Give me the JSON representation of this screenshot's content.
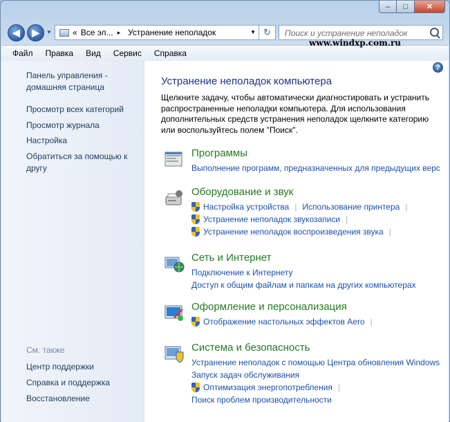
{
  "window": {
    "caption_buttons": {
      "minimize": "‒",
      "maximize": "□",
      "close": "✕"
    }
  },
  "navbar": {
    "back_icon": "arrow-left-icon",
    "forward_icon": "arrow-right-icon",
    "address_prefix": "«",
    "address_crumb1": "Все эл...",
    "address_separator": "▸",
    "address_crumb2": "Устранение неполадок",
    "search_placeholder": "Поиск и устранение неполадок"
  },
  "watermark": "www.windxp.com.ru",
  "menu": [
    "Файл",
    "Правка",
    "Вид",
    "Сервис",
    "Справка"
  ],
  "sidebar": {
    "home_link": "Панель управления - домашняя страница",
    "links": [
      "Просмотр всех категорий",
      "Просмотр журнала",
      "Настройка",
      "Обратиться за помощью к другу"
    ],
    "see_also_label": "См. также",
    "see_also_links": [
      "Центр поддержки",
      "Справка и поддержка",
      "Восстановление"
    ]
  },
  "main": {
    "help_icon": "?",
    "title": "Устранение неполадок компьютера",
    "description": "Щелкните задачу, чтобы автоматически диагностировать и устранить распространенные неполадки компьютера. Для использования дополнительных средств устранения неполадок щелкните категорию или воспользуйтесь полем \"Поиск\".",
    "categories": [
      {
        "title": "Программы",
        "icon": "programs-icon",
        "rows": [
          [
            {
              "text": "Выполнение программ, предназначенных для предыдущих версий Windows",
              "shield": false
            }
          ]
        ]
      },
      {
        "title": "Оборудование и звук",
        "icon": "hardware-sound-icon",
        "rows": [
          [
            {
              "text": "Настройка устройства",
              "shield": true
            },
            {
              "text": "Использование принтера",
              "shield": false
            }
          ],
          [
            {
              "text": "Устранение неполадок звукозаписи",
              "shield": true
            }
          ],
          [
            {
              "text": "Устранение неполадок воспроизведения звука",
              "shield": true
            }
          ]
        ]
      },
      {
        "title": "Сеть и Интернет",
        "icon": "network-internet-icon",
        "rows": [
          [
            {
              "text": "Подключение к Интернету",
              "shield": false
            }
          ],
          [
            {
              "text": "Доступ к общим файлам и папкам на других компьютерах",
              "shield": false
            }
          ]
        ]
      },
      {
        "title": "Оформление и персонализация",
        "icon": "appearance-personalization-icon",
        "rows": [
          [
            {
              "text": "Отображение настольных эффектов Aero",
              "shield": true
            }
          ]
        ]
      },
      {
        "title": "Система и безопасность",
        "icon": "system-security-icon",
        "rows": [
          [
            {
              "text": "Устранение неполадок с помощью Центра обновления Windows",
              "shield": false
            }
          ],
          [
            {
              "text": "Запуск задач обслуживания",
              "shield": false
            }
          ],
          [
            {
              "text": "Оптимизация энергопотребления",
              "shield": true
            }
          ],
          [
            {
              "text": "Поиск проблем производительности",
              "shield": false
            }
          ]
        ]
      }
    ]
  }
}
